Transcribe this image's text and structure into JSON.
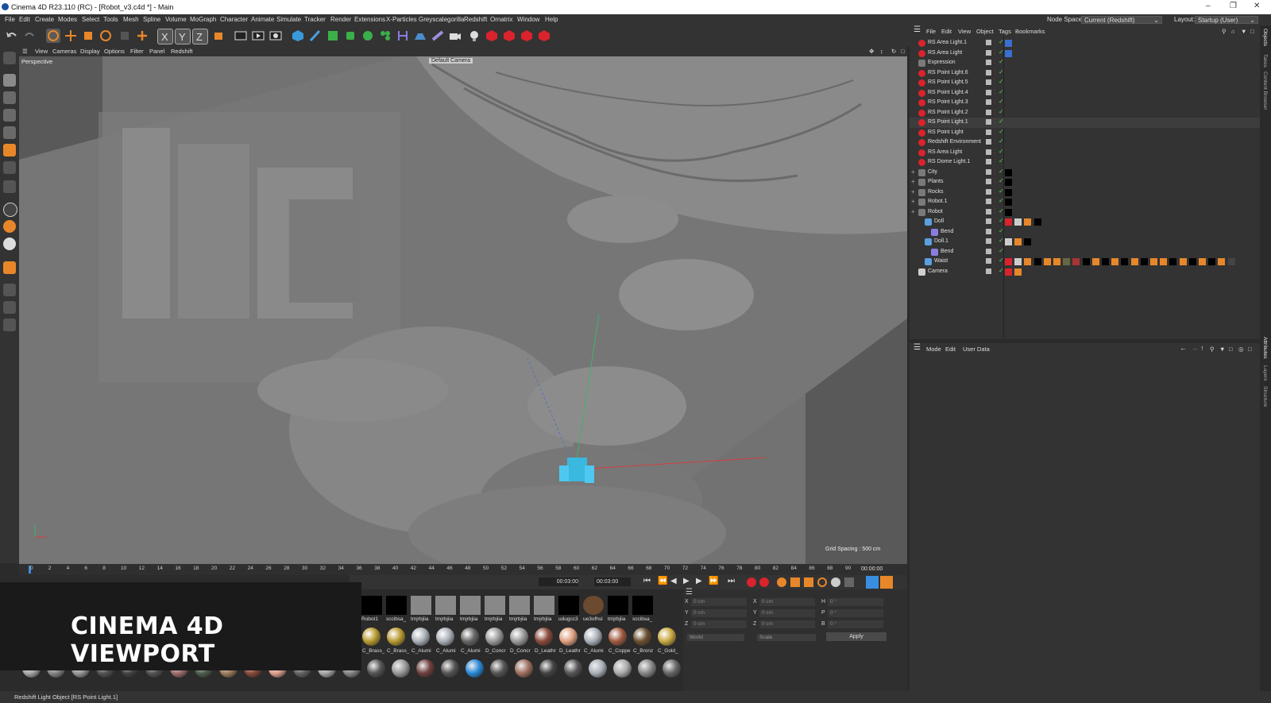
{
  "window": {
    "title": "Cinema 4D R23.110 (RC) - [Robot_v3.c4d *] - Main"
  },
  "menu": [
    "File",
    "Edit",
    "Create",
    "Modes",
    "Select",
    "Tools",
    "Mesh",
    "Spline",
    "Volume",
    "MoGraph",
    "Character",
    "Animate",
    "Simulate",
    "Tracker",
    "Render",
    "Extensions",
    "X-Particles",
    "Greyscalegorilla",
    "Redshift",
    "Ornatrix",
    "Window",
    "Help"
  ],
  "node_space": {
    "label": "Node Space:",
    "value": "Current (Redshift)"
  },
  "layout": {
    "label": "Layout:",
    "value": "Startup (User)"
  },
  "viewport": {
    "menu": [
      "View",
      "Cameras",
      "Display",
      "Options",
      "Filter",
      "Panel",
      "Redshift"
    ],
    "name": "Perspective",
    "camera": "Default Camera",
    "grid_spacing": "Grid Spacing : 500 cm"
  },
  "timeline": {
    "ticks": [
      "0",
      "2",
      "4",
      "6",
      "8",
      "10",
      "12",
      "14",
      "16",
      "18",
      "20",
      "22",
      "24",
      "26",
      "28",
      "30",
      "32",
      "34",
      "36",
      "38",
      "40",
      "42",
      "44",
      "46",
      "48",
      "50",
      "52",
      "54",
      "56",
      "58",
      "60",
      "62",
      "64",
      "66",
      "68",
      "70",
      "72",
      "74",
      "76",
      "78",
      "80",
      "82",
      "84",
      "86",
      "88",
      "90"
    ],
    "current_time": "00:00:00",
    "start": "00:03:00",
    "end": "00:03:00"
  },
  "object_manager": {
    "menu": [
      "File",
      "Edit",
      "View",
      "Object",
      "Tags",
      "Bookmarks"
    ],
    "objects": [
      {
        "name": "RS Area Light.1",
        "icon": "redshift-light-icon",
        "indent": 0
      },
      {
        "name": "RS Area Light",
        "icon": "redshift-light-icon",
        "indent": 0
      },
      {
        "name": "Expression",
        "icon": "null-icon",
        "indent": 0
      },
      {
        "name": "RS Point Light.6",
        "icon": "redshift-light-icon",
        "indent": 0
      },
      {
        "name": "RS Point Light.5",
        "icon": "redshift-light-icon",
        "indent": 0
      },
      {
        "name": "RS Point Light.4",
        "icon": "redshift-light-icon",
        "indent": 0
      },
      {
        "name": "RS Point Light.3",
        "icon": "redshift-light-icon",
        "indent": 0
      },
      {
        "name": "RS Point Light.2",
        "icon": "redshift-light-icon",
        "indent": 0
      },
      {
        "name": "RS Point Light.1",
        "icon": "redshift-light-icon",
        "indent": 0
      },
      {
        "name": "RS Point Light",
        "icon": "redshift-light-icon",
        "indent": 0
      },
      {
        "name": "Redshift Environment",
        "icon": "redshift-light-icon",
        "indent": 0
      },
      {
        "name": "RS Area Light",
        "icon": "redshift-light-icon",
        "indent": 0
      },
      {
        "name": "RS Dome Light.1",
        "icon": "redshift-light-icon",
        "indent": 0
      },
      {
        "name": "City",
        "icon": "null-icon",
        "indent": 0
      },
      {
        "name": "Plants",
        "icon": "null-icon",
        "indent": 0
      },
      {
        "name": "Rocks",
        "icon": "null-icon",
        "indent": 0
      },
      {
        "name": "Robot.1",
        "icon": "null-icon",
        "indent": 0
      },
      {
        "name": "Robot",
        "icon": "null-icon",
        "indent": 0
      },
      {
        "name": "Doll",
        "icon": "joint-icon",
        "indent": 1
      },
      {
        "name": "Bend",
        "icon": "deformer-icon",
        "indent": 2
      },
      {
        "name": "Doll.1",
        "icon": "joint-icon",
        "indent": 1
      },
      {
        "name": "Bend",
        "icon": "deformer-icon",
        "indent": 2
      },
      {
        "name": "Waist",
        "icon": "joint-icon",
        "indent": 1
      },
      {
        "name": "Camera",
        "icon": "camera-icon",
        "indent": 0
      }
    ]
  },
  "attribute_manager": {
    "menu": [
      "Mode",
      "Edit",
      "User Data"
    ]
  },
  "materials": {
    "row1": [
      "Robot1",
      "sccibsa_",
      "tmjrbjiia",
      "tmjrbjiia",
      "tmjrbjiia",
      "tmjrbjiia",
      "tmjrbjiia",
      "tmjrbjiia",
      "udugcc3",
      "ue3ofhsl",
      "tmjrbjiia",
      "sccibsa_"
    ],
    "row2": [
      "C_Brass_",
      "C_Brass_",
      "C_Alumi",
      "C_Alumi",
      "C_Alumi",
      "D_Concr",
      "D_Concr",
      "D_Leathr",
      "D_Leathr",
      "C_Alumi",
      "C_Coppe",
      "C_Bronz",
      "C_Gold_"
    ]
  },
  "coordinates": {
    "rows": [
      {
        "a": "X",
        "av": "0 cm",
        "b": "X",
        "bv": "0 cm",
        "c": "H",
        "cv": "0 °"
      },
      {
        "a": "Y",
        "av": "0 cm",
        "b": "Y",
        "bv": "0 cm",
        "c": "P",
        "cv": "0 °"
      },
      {
        "a": "Z",
        "av": "0 cm",
        "b": "Z",
        "bv": "0 cm",
        "c": "B",
        "cv": "0 °"
      }
    ],
    "mode1": "World",
    "mode2": "Scale",
    "apply": "Apply"
  },
  "overlay_label": "CINEMA 4D VIEWPORT",
  "status": "Redshift Light Object [RS Point Light.1]",
  "right_tabs": [
    "Objects",
    "Takes",
    "Content Browser",
    "Attributes",
    "Layers",
    "Structure"
  ],
  "colors": {
    "accent": "#e8872a",
    "redshift": "#d9232d",
    "viewport_bg": "#707070",
    "selection": "#3aa0e0"
  }
}
